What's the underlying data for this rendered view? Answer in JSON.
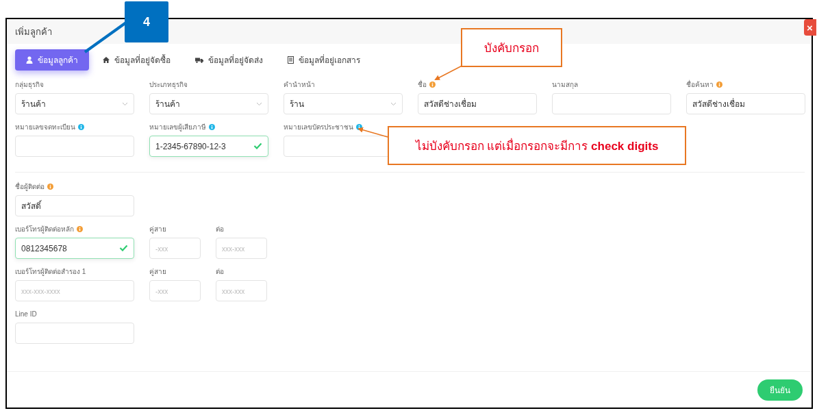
{
  "dialog": {
    "title": "เพิ่มลูกค้า",
    "close_label": "×"
  },
  "tabs": [
    {
      "label": "ข้อมูลลูกค้า",
      "selected": true
    },
    {
      "label": "ข้อมูลที่อยู่จัดซื้อ",
      "selected": false
    },
    {
      "label": "ข้อมูลที่อยู่จัดส่ง",
      "selected": false
    },
    {
      "label": "ข้อมูลที่อยู่เอกสาร",
      "selected": false
    }
  ],
  "sections": [
    {
      "rows": [
        {
          "fields": [
            {
              "kind": "select",
              "label": "กลุ่มธุรกิจ",
              "value": "ร้านค้า"
            },
            {
              "kind": "select",
              "label": "ประเภทธุรกิจ",
              "value": "ร้านค้า"
            },
            {
              "kind": "select",
              "label": "คำนำหน้า",
              "value": "ร้าน"
            },
            {
              "kind": "text",
              "label": "ชื่อ",
              "info": {
                "color": "#f39c34"
              },
              "value": "สวัสดีช่างเชื่อม"
            },
            {
              "kind": "text",
              "label": "นามสกุล"
            },
            {
              "kind": "text",
              "label": "ชื่อค้นหา",
              "info": {
                "color": "#f39c34"
              },
              "value": "สวัสดีช่างเชื่อม"
            }
          ]
        },
        {
          "fields": [
            {
              "kind": "text",
              "label": "หมายเลขจดทะเบียน",
              "info": {
                "color": "#1fb6e8"
              }
            },
            {
              "kind": "text",
              "label": "หมายเลขผู้เสียภาษี",
              "info": {
                "color": "#1fb6e8"
              },
              "value": "1-2345-67890-12-3",
              "valid": true
            },
            {
              "kind": "text",
              "label": "หมายเลขบัตรประชาชน",
              "info": {
                "color": "#1fb6e8"
              }
            }
          ]
        }
      ]
    },
    {
      "rows": [
        {
          "fields": [
            {
              "kind": "text",
              "label": "ชื่อผู้ติดต่อ",
              "info": {
                "color": "#f39c34"
              },
              "value": "สวัสดิ์"
            }
          ]
        },
        {
          "fields": [
            {
              "kind": "text",
              "label": "เบอร์โทรผู้ติดต่อหลัก",
              "info": {
                "color": "#f39c34"
              },
              "value": "0812345678",
              "valid": true
            },
            {
              "kind": "short",
              "label": "คู่สาย",
              "placeholder": "-xxx"
            },
            {
              "kind": "short",
              "label": "ต่อ",
              "placeholder": "xxx-xxx"
            }
          ]
        },
        {
          "fields": [
            {
              "kind": "text",
              "label": "เบอร์โทรผู้ติดต่อสำรอง 1",
              "placeholder": "xxx-xxx-xxxx"
            },
            {
              "kind": "short",
              "label": "คู่สาย",
              "placeholder": "-xxx"
            },
            {
              "kind": "short",
              "label": "ต่อ",
              "placeholder": "xxx-xxx"
            }
          ]
        },
        {
          "fields": [
            {
              "kind": "text",
              "label": "Line ID"
            }
          ]
        }
      ]
    }
  ],
  "confirm_button": "ยืนยัน",
  "annotations": [
    {
      "kind": "badge",
      "text": "4"
    },
    {
      "kind": "note",
      "text": "บังคับกรอก"
    },
    {
      "kind": "note",
      "text": "ไม่บังคับกรอก แต่เมื่อกรอกจะมีการ **check digits**"
    }
  ]
}
